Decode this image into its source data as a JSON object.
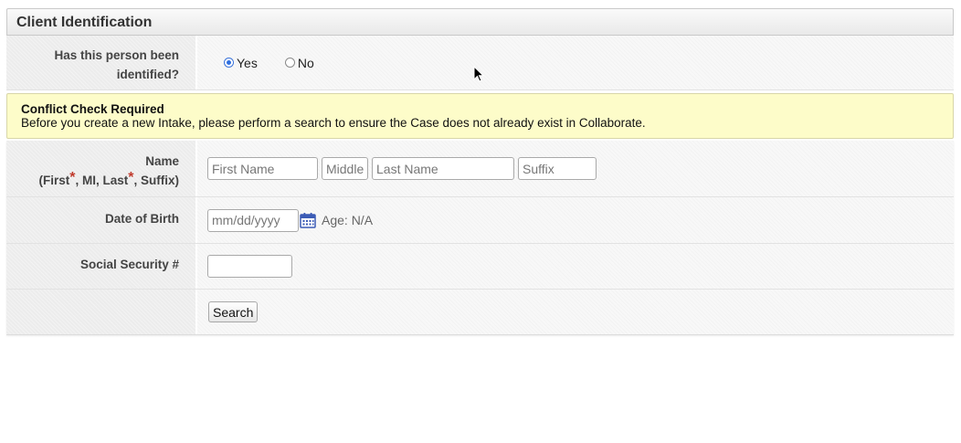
{
  "panel": {
    "title": "Client Identification"
  },
  "identified": {
    "label": "Has this person been identified?",
    "options": [
      {
        "label": "Yes",
        "checked": true
      },
      {
        "label": "No",
        "checked": false
      }
    ]
  },
  "alert": {
    "title": "Conflict Check Required",
    "message": "Before you create a new Intake, please perform a search to ensure the Case does not already exist in Collaborate."
  },
  "name_row": {
    "label_line1": "Name",
    "label_first": "(First",
    "label_mid": ", MI, Last",
    "label_end": ", Suffix)",
    "required_mark": "*",
    "first_placeholder": "First Name",
    "middle_placeholder": "Middle",
    "last_placeholder": "Last Name",
    "suffix_placeholder": "Suffix"
  },
  "dob_row": {
    "label": "Date of Birth",
    "placeholder": "mm/dd/yyyy",
    "age_text": "Age: N/A"
  },
  "ssn_row": {
    "label": "Social Security #",
    "value": ""
  },
  "search_row": {
    "button_label": "Search"
  },
  "icons": {
    "calendar": "calendar-icon",
    "cursor": "mouse-cursor-icon"
  },
  "colors": {
    "alert_bg": "#fdfcc9",
    "required": "#c0392b",
    "calendar": "#3b5bb5",
    "radio_selected": "#2f6fe0"
  }
}
